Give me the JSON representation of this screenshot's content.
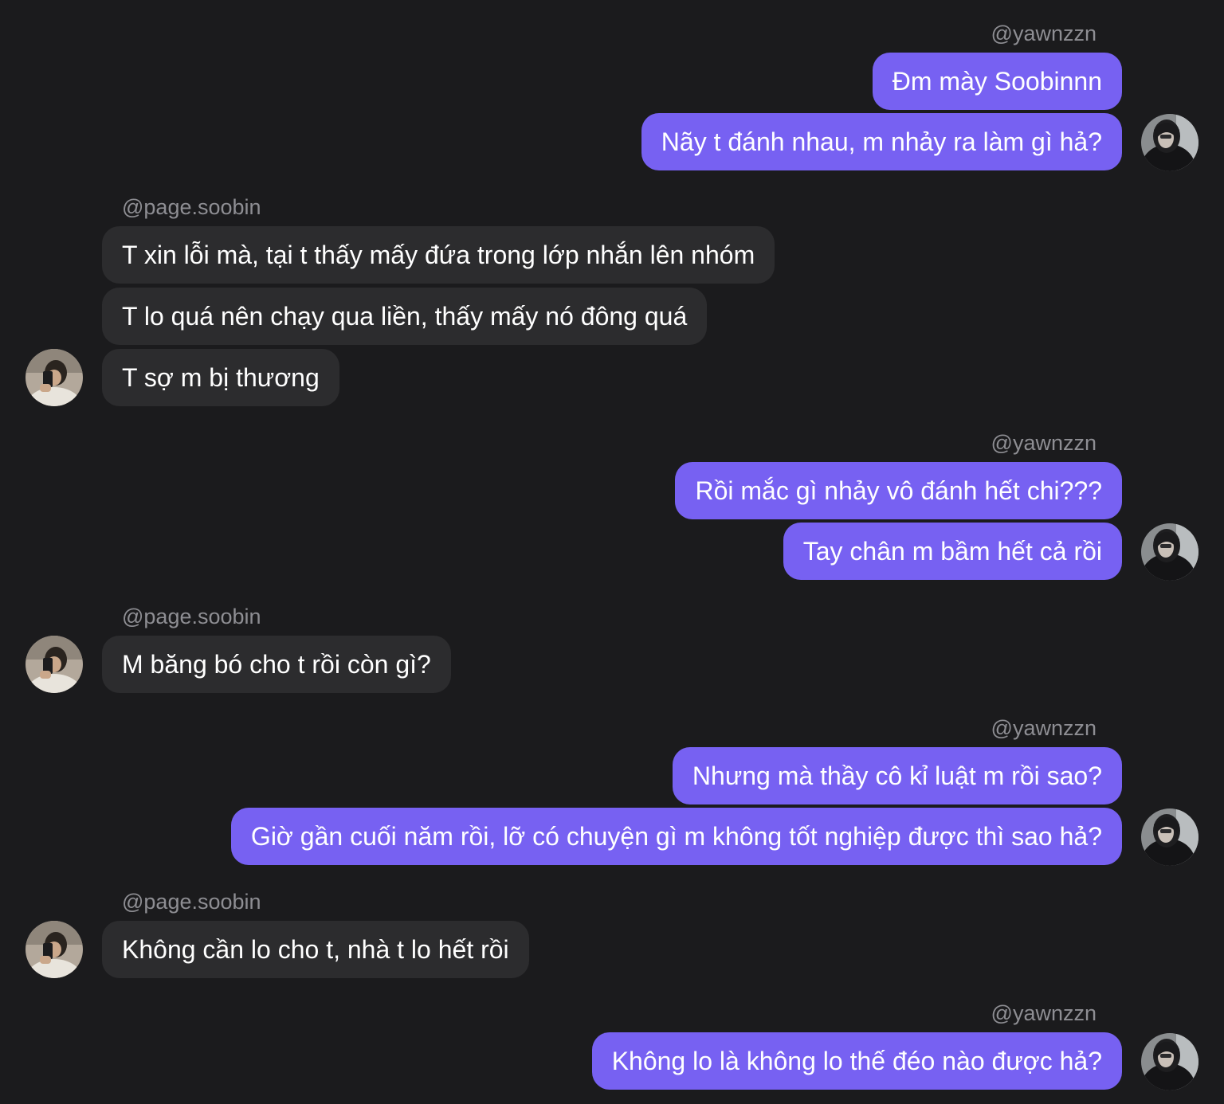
{
  "users": {
    "me": {
      "handle": "@yawnzzn",
      "avatar_icon": "dark-hood-avatar-icon"
    },
    "other": {
      "handle": "@page.soobin",
      "avatar_icon": "boy-selfie-avatar-icon"
    }
  },
  "colors": {
    "background": "#1b1b1d",
    "outgoing_bubble": "#7761f2",
    "incoming_bubble": "#2c2c2e",
    "username_text": "#8e8e93"
  },
  "groups": [
    {
      "sender": "@yawnzzn",
      "messages": [
        "Đm mày Soobinnn",
        "Nãy t đánh nhau, m nhảy ra làm gì hả?"
      ]
    },
    {
      "sender": "@page.soobin",
      "messages": [
        "T xin lỗi mà, tại t thấy mấy đứa trong lớp nhắn lên nhóm",
        "T lo quá nên chạy qua liền, thấy mấy nó đông quá",
        "T sợ m bị thương"
      ]
    },
    {
      "sender": "@yawnzzn",
      "messages": [
        "Rồi mắc gì nhảy vô đánh hết chi???",
        "Tay chân m bầm hết cả rồi"
      ]
    },
    {
      "sender": "@page.soobin",
      "messages": [
        "M băng bó cho t rồi còn gì?"
      ]
    },
    {
      "sender": "@yawnzzn",
      "messages": [
        "Nhưng mà thầy cô kỉ luật m rồi sao?",
        "Giờ gần cuối năm rồi, lỡ có chuyện gì m không tốt nghiệp được thì sao hả?"
      ]
    },
    {
      "sender": "@page.soobin",
      "messages": [
        "Không cần lo cho t, nhà t lo hết rồi"
      ]
    },
    {
      "sender": "@yawnzzn",
      "messages": [
        "Không lo là không lo thế đéo nào được hả?"
      ]
    }
  ]
}
